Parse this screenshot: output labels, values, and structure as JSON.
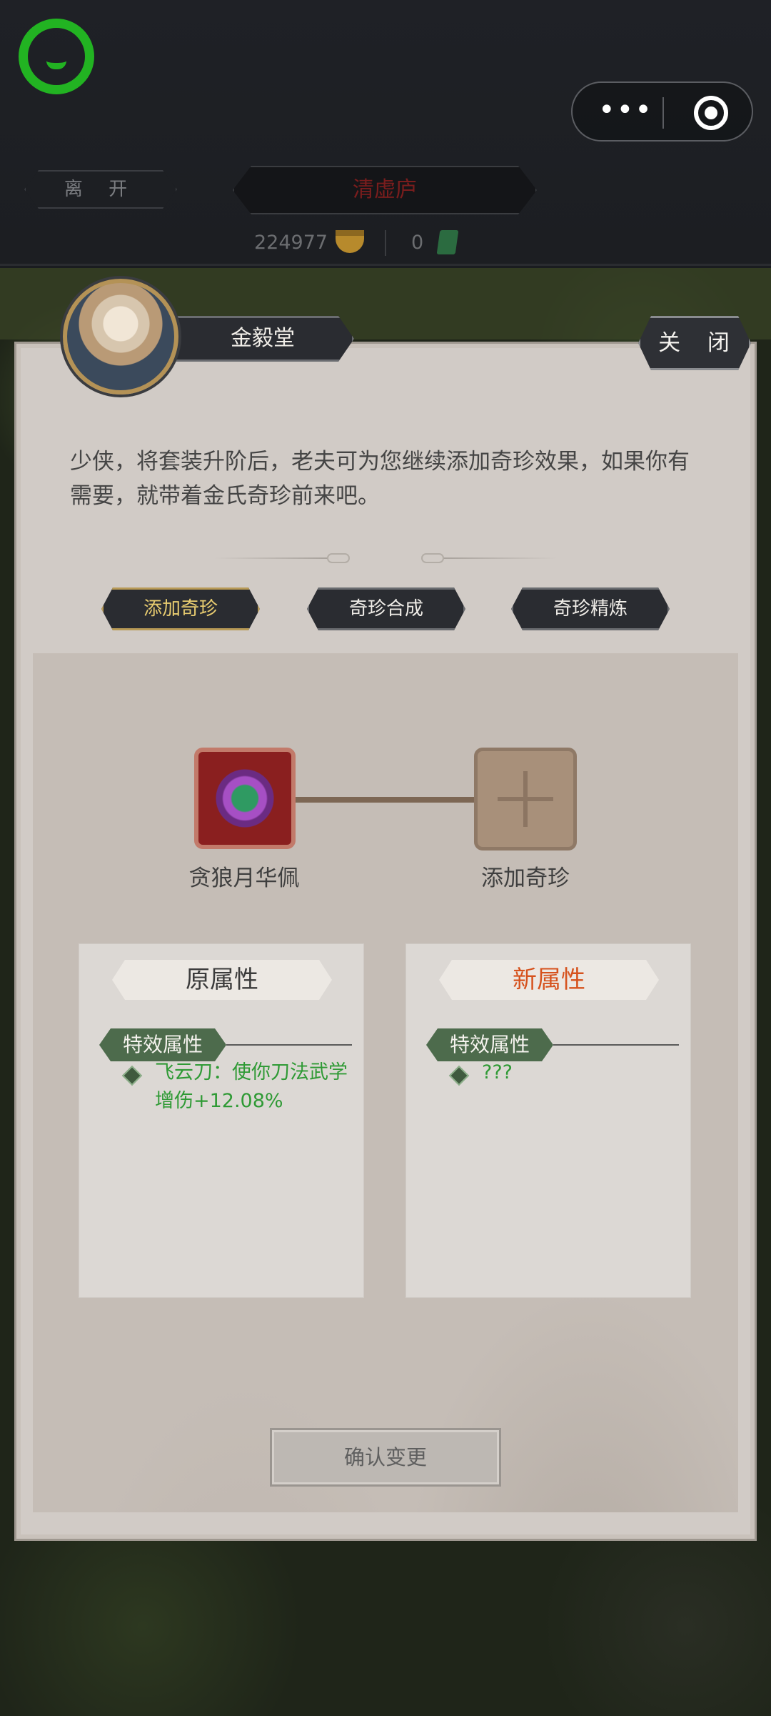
{
  "topbar": {
    "leave_label": "离 开",
    "location": "清虚庐",
    "gold_amount": "224977",
    "jade_amount": "0"
  },
  "npc": {
    "name": "金毅堂",
    "close_label": "关 闭",
    "intro": "少侠，将套装升阶后，老夫可为您继续添加奇珍效果，如果你有需要，就带着金氏奇珍前来吧。"
  },
  "tabs": [
    {
      "label": "添加奇珍",
      "active": true
    },
    {
      "label": "奇珍合成",
      "active": false
    },
    {
      "label": "奇珍精炼",
      "active": false
    }
  ],
  "slots": {
    "item_label": "贪狼月华佩",
    "add_label": "添加奇珍"
  },
  "original": {
    "title": "原属性",
    "tag": "特效属性",
    "effect": "飞云刀：使你刀法武学增伤+12.08%"
  },
  "new": {
    "title": "新属性",
    "tag": "特效属性",
    "effect": "???"
  },
  "confirm_label": "确认变更",
  "colors": {
    "effect_green": "#2f9a35",
    "new_title_orange": "#d6521d",
    "active_tab_gold": "#e8cc70"
  }
}
